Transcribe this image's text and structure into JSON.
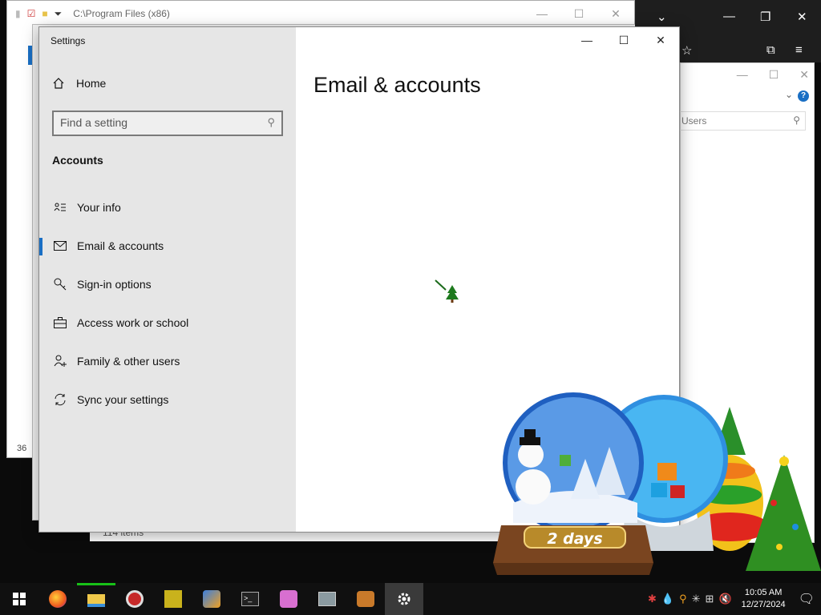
{
  "background_explorer": {
    "path": "C:\\Program Files (x86)",
    "item_count_partial": "36",
    "items_label": "114 items"
  },
  "right_window": {
    "search_text": "Users",
    "help_glyph": "?"
  },
  "settings": {
    "app_title": "Settings",
    "home_label": "Home",
    "search_placeholder": "Find a setting",
    "section_title": "Accounts",
    "nav_items": [
      {
        "label": "Your info",
        "icon": "person-card-icon"
      },
      {
        "label": "Email & accounts",
        "icon": "mail-icon",
        "active": true
      },
      {
        "label": "Sign-in options",
        "icon": "key-icon"
      },
      {
        "label": "Access work or school",
        "icon": "briefcase-icon"
      },
      {
        "label": "Family & other users",
        "icon": "person-add-icon"
      },
      {
        "label": "Sync your settings",
        "icon": "sync-icon"
      }
    ],
    "page_title": "Email & accounts",
    "controls": {
      "minimize": "—",
      "maximize": "☐",
      "close": "✕"
    }
  },
  "decoration": {
    "countdown_label": "2 days"
  },
  "taskbar": {
    "clock_time": "10:05 AM",
    "clock_date": "12/27/2024",
    "apps": [
      "start-icon",
      "firefox-icon",
      "file-explorer-icon",
      "app-red-icon",
      "app-yellow-icon",
      "app-blue-icon",
      "terminal-icon",
      "app-pink-icon",
      "app-gray-icon",
      "app-cat-icon",
      "settings-icon"
    ]
  }
}
